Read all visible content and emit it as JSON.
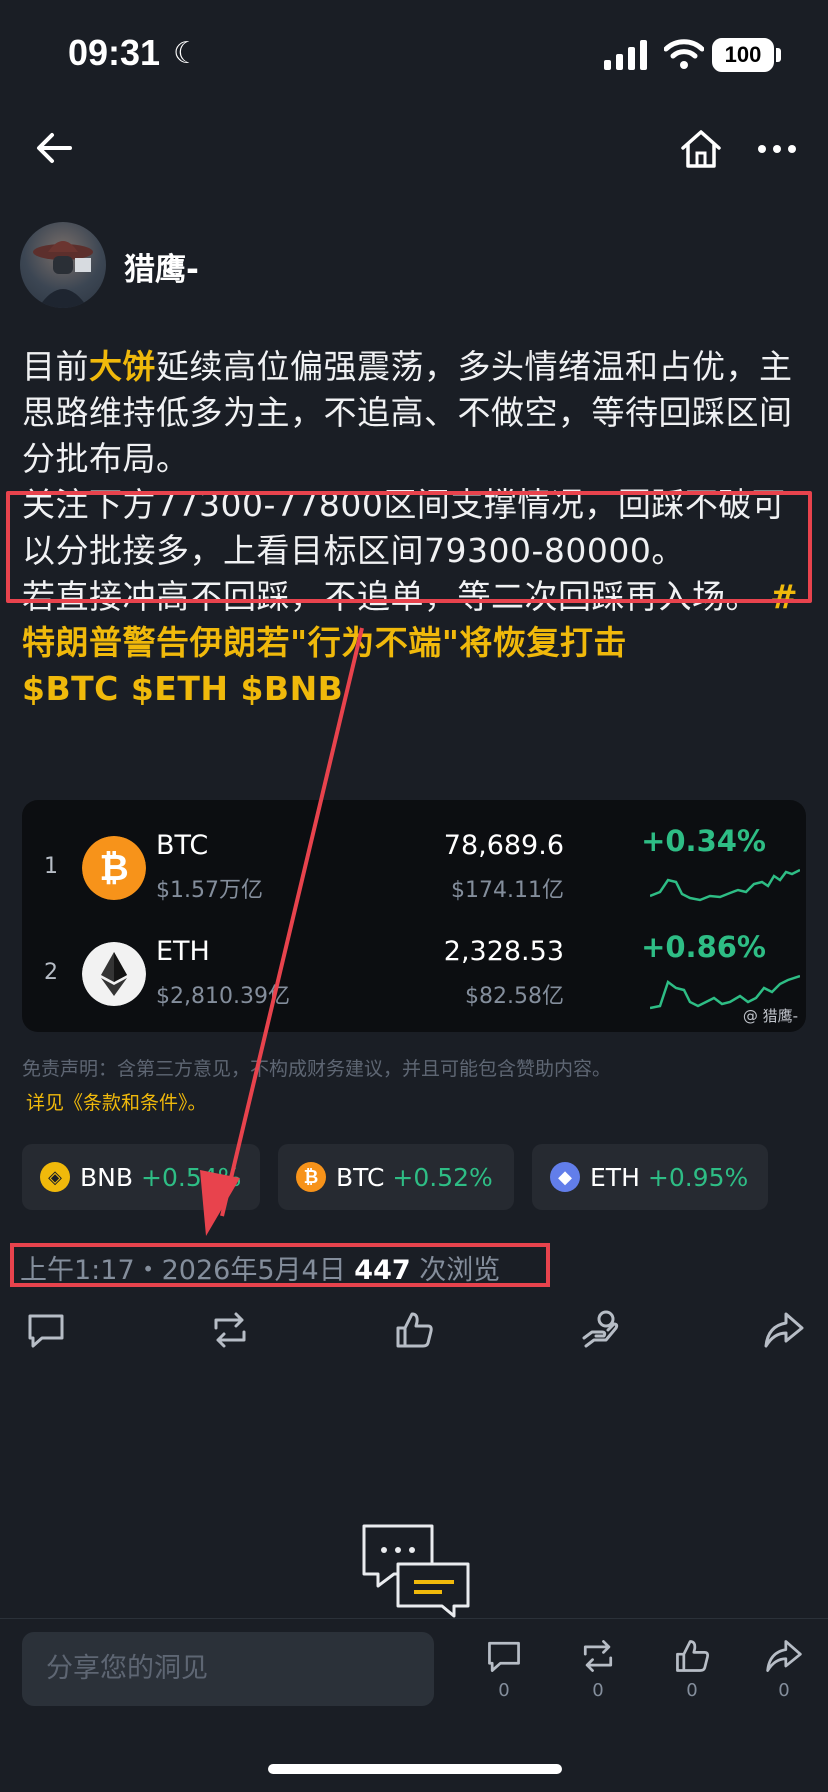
{
  "status_bar": {
    "time": "09:31",
    "battery": "100"
  },
  "author": {
    "name": "猎鹰-"
  },
  "post": {
    "seg1": "目前",
    "seg2_highlight": "大饼",
    "seg3": "延续高位偏强震荡，多头情绪温和占优，主思路维持低多为主，不追高、不做空，等待回踩区间分批布局。",
    "seg4": "关注下方77300-77800区间支撑情况，回踩不破可以分批接多，上看目标区间79300-80000。",
    "seg5": "若直接冲高不回踩，不追单，等二次回踩再入场。",
    "hashtag": "#特朗普警告伊朗若\"行为不端\"将恢复打击",
    "cashtags": "$BTC $ETH $BNB"
  },
  "coin_card": {
    "rows": [
      {
        "rank": "1",
        "name": "BTC",
        "mcap": "$1.57万亿",
        "price": "78,689.6",
        "volume": "$174.11亿",
        "change": "+0.34%"
      },
      {
        "rank": "2",
        "name": "ETH",
        "mcap": "$2,810.39亿",
        "price": "2,328.53",
        "volume": "$82.58亿",
        "change": "+0.86%"
      }
    ],
    "watermark": "@ 猎鹰-"
  },
  "disclaimer": {
    "text": "免责声明：含第三方意见，不构成财务建议，并且可能包含赞助内容。",
    "terms": "详见《条款和条件》。"
  },
  "chips": [
    {
      "symbol": "BNB",
      "change": "+0.54%"
    },
    {
      "symbol": "BTC",
      "change": "+0.52%"
    },
    {
      "symbol": "ETH",
      "change": "+0.95%"
    }
  ],
  "meta": {
    "datetime": "上午1:17・2026年5月4日",
    "views": "447",
    "views_label": "次浏览"
  },
  "composer": {
    "placeholder": "分享您的洞见"
  },
  "bottom_counts": {
    "comments": "0",
    "reposts": "0",
    "likes": "0",
    "shares": "0"
  },
  "colors": {
    "accent": "#f0b90b",
    "up": "#2ebd85",
    "annotation": "#e8434d",
    "background": "#1a1e25"
  }
}
